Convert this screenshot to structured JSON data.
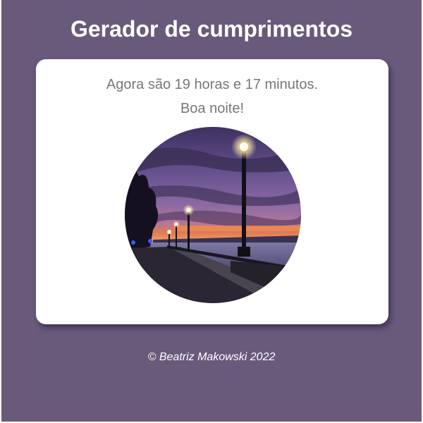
{
  "header": {
    "title": "Gerador de cumprimentos"
  },
  "card": {
    "time_message": "Agora são 19 horas e 17 minutos.",
    "greeting": "Boa noite!",
    "photo": {
      "subject": "waterfront promenade with street lamps at dusk",
      "period": "night"
    }
  },
  "footer": {
    "copyright": "© Beatriz Makowski 2022"
  },
  "colors": {
    "page_background": "#695a7c",
    "card_background": "#ffffff",
    "title_text": "#ffffff",
    "body_text": "#777777"
  }
}
